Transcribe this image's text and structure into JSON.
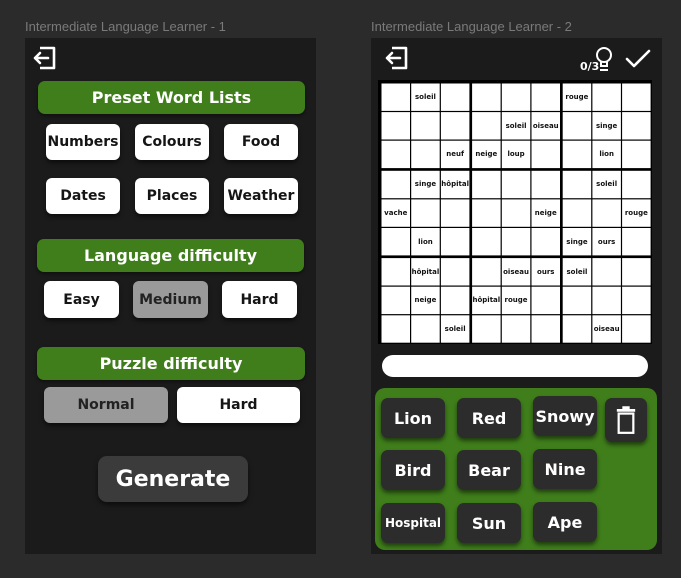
{
  "frames": [
    {
      "label": "Intermediate Language Learner - 1"
    },
    {
      "label": "Intermediate Language Learner - 2"
    }
  ],
  "screen1": {
    "preset_title": "Preset Word Lists",
    "presets": [
      "Numbers",
      "Colours",
      "Food",
      "Dates",
      "Places",
      "Weather"
    ],
    "language_title": "Language difficulty",
    "language_levels": [
      "Easy",
      "Medium",
      "Hard"
    ],
    "language_selected": "Medium",
    "puzzle_title": "Puzzle difficulty",
    "puzzle_levels": [
      "Normal",
      "Hard"
    ],
    "puzzle_selected": "Normal",
    "generate_label": "Generate"
  },
  "screen2": {
    "counter": "0/3",
    "grid": [
      [
        "",
        "soleil",
        "",
        "",
        "",
        "",
        "rouge",
        "",
        ""
      ],
      [
        "",
        "",
        "",
        "",
        "soleil",
        "oiseau",
        "",
        "singe",
        ""
      ],
      [
        "",
        "",
        "neuf",
        "neige",
        "loup",
        "",
        "",
        "lion",
        ""
      ],
      [
        "",
        "singe",
        "hôpital",
        "",
        "",
        "",
        "",
        "soleil",
        ""
      ],
      [
        "vache",
        "",
        "",
        "",
        "",
        "neige",
        "",
        "",
        "rouge"
      ],
      [
        "",
        "lion",
        "",
        "",
        "",
        "",
        "singe",
        "ours",
        ""
      ],
      [
        "",
        "hôpital",
        "",
        "",
        "oiseau",
        "ours",
        "soleil",
        "",
        ""
      ],
      [
        "",
        "neige",
        "",
        "hôpital",
        "rouge",
        "",
        "",
        "",
        ""
      ],
      [
        "",
        "",
        "soleil",
        "",
        "",
        "",
        "",
        "oiseau",
        ""
      ]
    ],
    "answer_value": "",
    "words": [
      "Lion",
      "Red",
      "Snowy",
      "Bird",
      "Bear",
      "Nine",
      "Hospital",
      "Sun",
      "Ape"
    ]
  }
}
